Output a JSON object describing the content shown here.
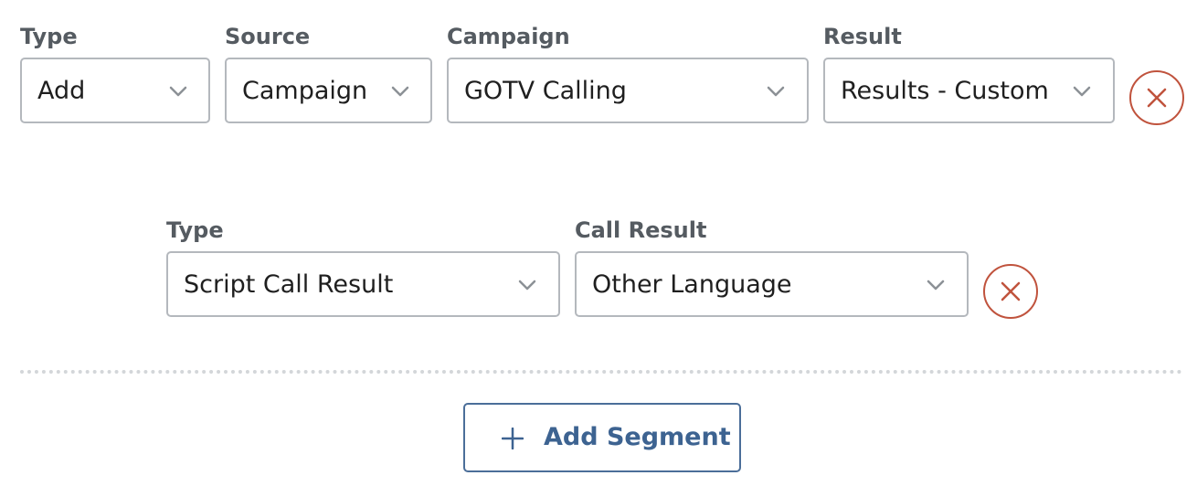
{
  "rule_row": {
    "type": {
      "label": "Type",
      "value": "Add"
    },
    "source": {
      "label": "Source",
      "value": "Campaign"
    },
    "campaign": {
      "label": "Campaign",
      "value": "GOTV Calling"
    },
    "result": {
      "label": "Result",
      "value": "Results - Custom"
    }
  },
  "sub_row": {
    "type": {
      "label": "Type",
      "value": "Script Call Result"
    },
    "call_result": {
      "label": "Call Result",
      "value": "Other Language"
    }
  },
  "add_segment": {
    "label": "Add Segment"
  },
  "icons": {
    "select_caret": "chevron-down-icon",
    "remove": "close-icon",
    "add": "plus-icon"
  },
  "colors": {
    "label_text": "#555b61",
    "border": "#b4b8bd",
    "remove_accent": "#c0533d",
    "primary": "#3d6391"
  }
}
